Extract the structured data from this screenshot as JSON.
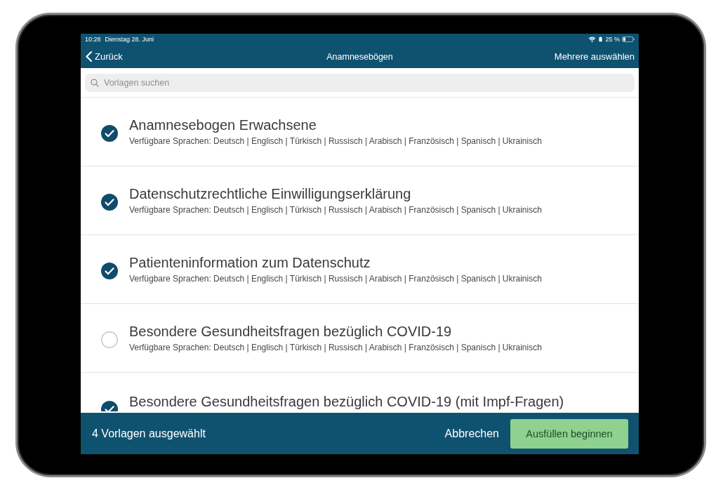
{
  "status_bar": {
    "time": "10:28",
    "date": "Dienstag 28. Juni",
    "battery": "25 %"
  },
  "nav_bar": {
    "back": "Zurück",
    "title": "Anamnesebögen",
    "action": "Mehrere auswählen"
  },
  "search": {
    "placeholder": "Vorlagen suchen"
  },
  "templates": [
    {
      "title": "Anamnesebogen Erwachsene",
      "subtitle": "Verfügbare Sprachen: Deutsch | Englisch | Türkisch | Russisch | Arabisch | Französisch | Spanisch | Ukrainisch",
      "selected": true
    },
    {
      "title": "Datenschutzrechtliche Einwilligungserklärung",
      "subtitle": "Verfügbare Sprachen: Deutsch | Englisch | Türkisch | Russisch | Arabisch | Französisch | Spanisch | Ukrainisch",
      "selected": true
    },
    {
      "title": "Patienteninformation zum Datenschutz",
      "subtitle": "Verfügbare Sprachen: Deutsch | Englisch | Türkisch | Russisch | Arabisch | Französisch | Spanisch | Ukrainisch",
      "selected": true
    },
    {
      "title": "Besondere Gesundheitsfragen bezüglich COVID-19",
      "subtitle": "Verfügbare Sprachen: Deutsch | Englisch | Türkisch | Russisch | Arabisch | Französisch | Spanisch | Ukrainisch",
      "selected": false
    },
    {
      "title": "Besondere Gesundheitsfragen bezüglich COVID-19 (mit Impf-Fragen)",
      "selected": true
    }
  ],
  "bottom_bar": {
    "count": "4 Vorlagen ausgewählt",
    "cancel": "Abbrechen",
    "start": "Ausfüllen beginnen"
  }
}
